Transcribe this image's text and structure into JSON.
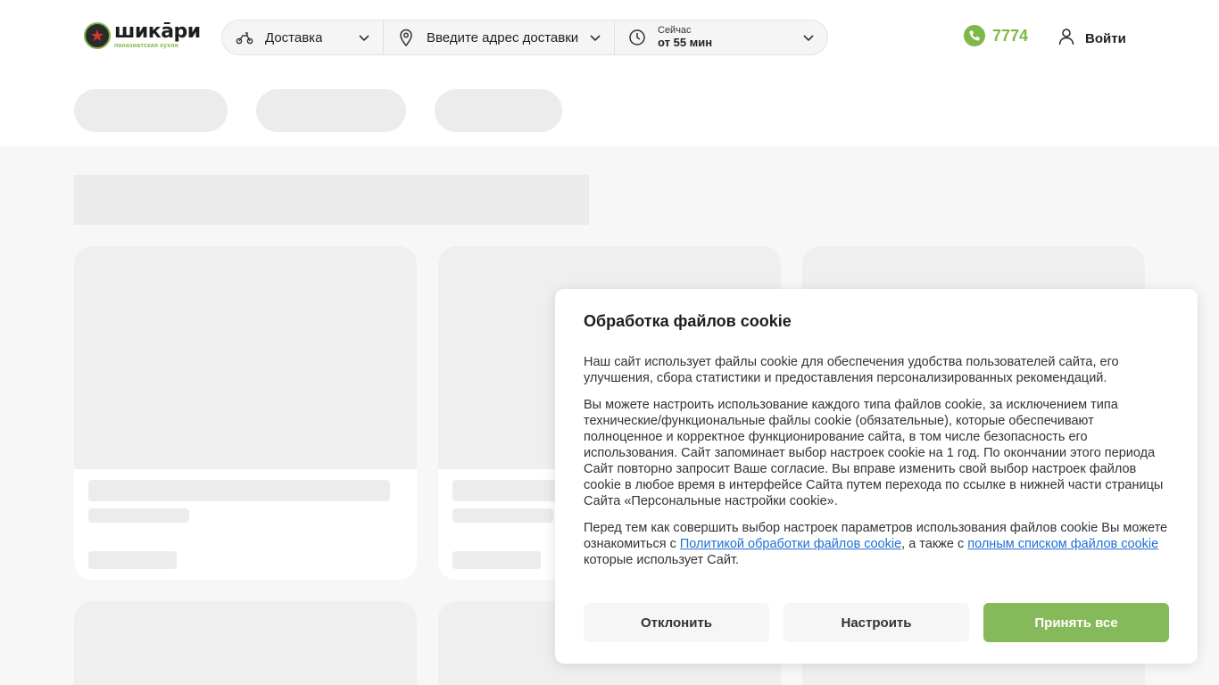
{
  "header": {
    "logo_title": "шикāри",
    "logo_subtitle": "паназиатская кухня",
    "delivery_label": "Доставка",
    "address_placeholder": "Введите адрес доставки",
    "time_small": "Сейчас",
    "time_main": "от 55 мин",
    "phone": "7774",
    "login_label": "Войти"
  },
  "colors": {
    "brand_green": "#7fb84a",
    "accept_button": "#86b95a",
    "skeleton": "#ececec",
    "link": "#1f6fd6"
  },
  "icons": {
    "delivery": "scooter-icon",
    "address": "location-pin-icon",
    "time": "clock-icon",
    "phone": "phone-icon",
    "login": "user-icon",
    "chevron": "chevron-down-icon"
  },
  "cookie": {
    "title": "Обработка файлов cookie",
    "para1": "Наш сайт использует файлы cookie для обеспечения удобства пользователей сайта, его улучшения, сбора статистики и предоставления персонализированных рекомендаций.",
    "para2": "Вы можете настроить использование каждого типа файлов cookie, за исключением типа технические/функциональные файлы cookie (обязательные), которые обеспечивают полноценное и корректное функционирование сайта, в том числе безопасность его использования. Сайт запоминает выбор настроек cookie на 1 год. По окончании этого периода Сайт повторно запросит Ваше согласие. Вы вправе изменить свой выбор настроек файлов cookie в любое время в интерфейсе Сайта путем перехода по ссылке в нижней части страницы Сайта «Персональные настройки cookie».",
    "para3_start": "Перед тем как совершить выбор настроек параметров использования файлов cookie Вы можете ознакомиться с ",
    "link_policy": "Политикой обработки файлов cookie",
    "para3_mid": ", а также с ",
    "link_list": "полным списком файлов cookie",
    "para3_end": " которые использует Сайт.",
    "btn_decline": "Отклонить",
    "btn_config": "Настроить",
    "btn_accept": "Принять все"
  }
}
